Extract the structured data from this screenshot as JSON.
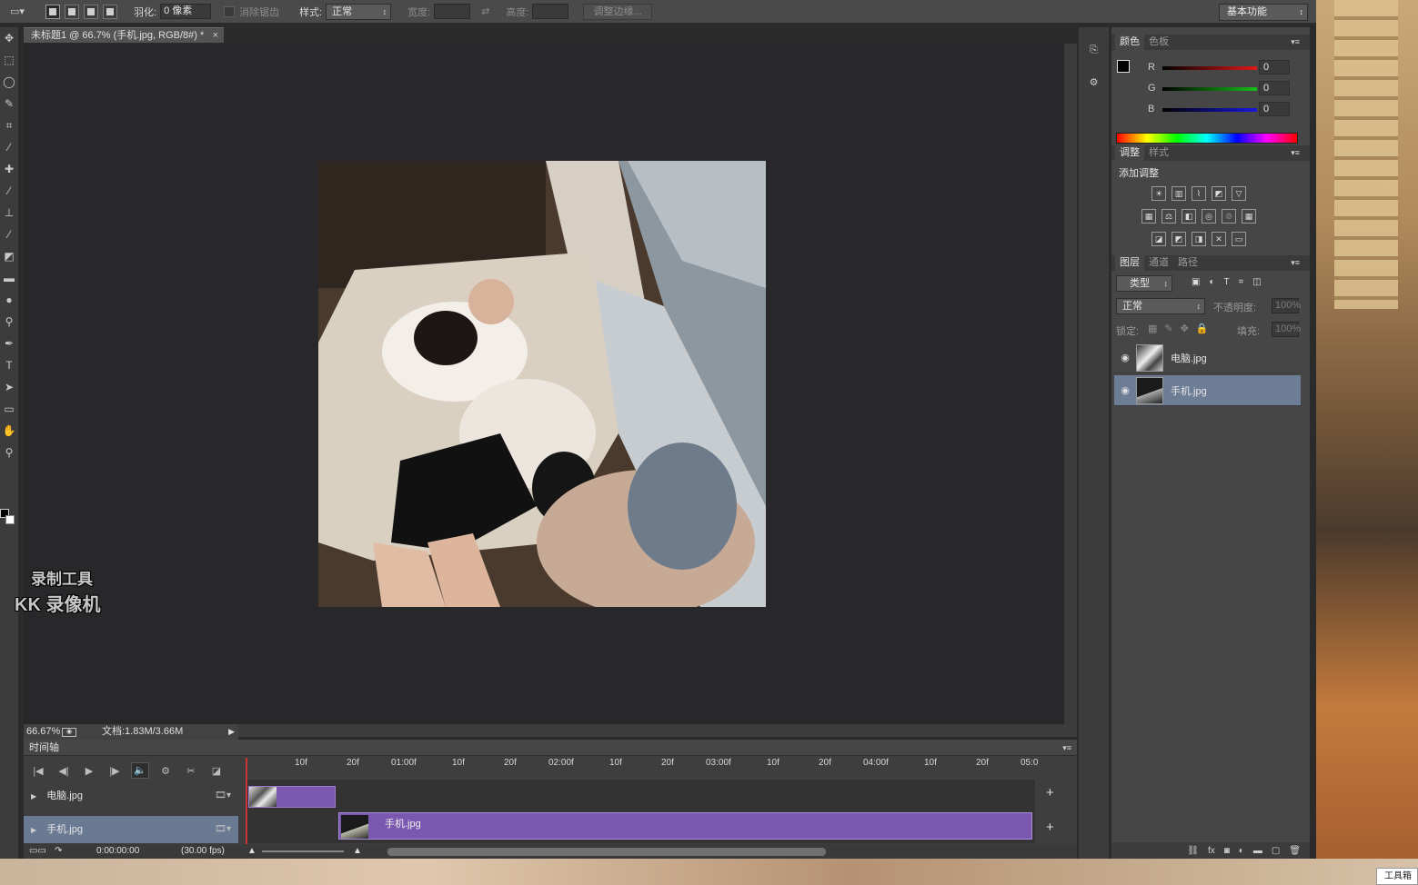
{
  "options_bar": {
    "feather_label": "羽化:",
    "feather_value": "0 像素",
    "antialias_label": "消除锯齿",
    "style_label": "样式:",
    "style_value": "正常",
    "width_label": "宽度:",
    "height_label": "高度:",
    "refine_edge_label": "调整边缘..."
  },
  "workspace": "基本功能",
  "document": {
    "tab_title": "未标题1 @ 66.7% (手机.jpg, RGB/8#) *",
    "zoom": "66.67%",
    "doc_size": "文档:1.83M/3.66M"
  },
  "watermark": {
    "line1": "录制工具",
    "line2": "KK 录像机"
  },
  "timeline": {
    "title": "时间轴",
    "ruler": [
      "10f",
      "20f",
      "01:00f",
      "10f",
      "20f",
      "02:00f",
      "10f",
      "20f",
      "03:00f",
      "10f",
      "20f",
      "04:00f",
      "10f",
      "20f",
      "05:0"
    ],
    "tracks": [
      {
        "name": "电脑.jpg",
        "selected": false
      },
      {
        "name": "手机.jpg",
        "selected": true
      }
    ],
    "clip_label": "手机.jpg",
    "time": "0:00:00:00",
    "fps": "(30.00 fps)"
  },
  "color_panel": {
    "tabs": [
      "颜色",
      "色板"
    ],
    "channels": [
      {
        "name": "R",
        "value": "0",
        "color": "#e01818"
      },
      {
        "name": "G",
        "value": "0",
        "color": "#18c018"
      },
      {
        "name": "B",
        "value": "0",
        "color": "#1818e0"
      }
    ]
  },
  "adjust_panel": {
    "tabs": [
      "调整",
      "样式"
    ],
    "title": "添加调整"
  },
  "layers_panel": {
    "tabs": [
      "图层",
      "通道",
      "路径"
    ],
    "filter": "类型",
    "blend_mode": "正常",
    "opacity_label": "不透明度:",
    "opacity_value": "100%",
    "lock_label": "锁定:",
    "fill_label": "填充:",
    "fill_value": "100%",
    "layers": [
      {
        "name": "电脑.jpg",
        "selected": false
      },
      {
        "name": "手机.jpg",
        "selected": true
      }
    ]
  },
  "taskbar_tooltip": "工具箱"
}
